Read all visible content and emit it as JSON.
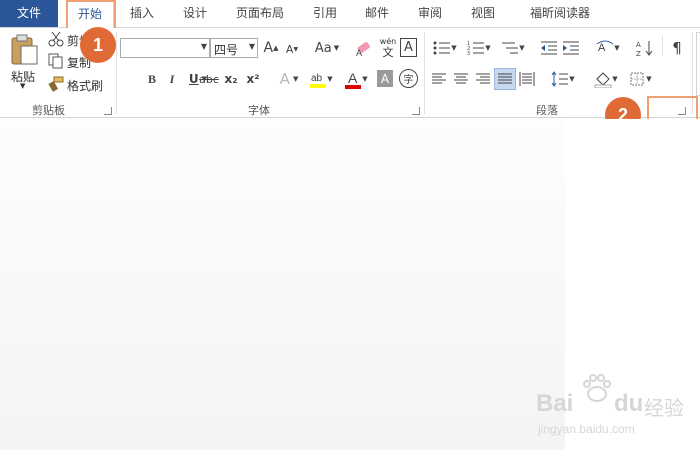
{
  "tabs": [
    {
      "label": "文件"
    },
    {
      "label": "开始"
    },
    {
      "label": "插入"
    },
    {
      "label": "设计"
    },
    {
      "label": "页面布局"
    },
    {
      "label": "引用"
    },
    {
      "label": "邮件"
    },
    {
      "label": "审阅"
    },
    {
      "label": "视图"
    },
    {
      "label": "福昕阅读器"
    }
  ],
  "badges": {
    "one": "1",
    "two": "2"
  },
  "clipboard": {
    "paste_label": "粘贴",
    "cut_label": "剪切",
    "copy_label": "复制",
    "format_painter_label": "格式刷",
    "group_label": "剪贴板"
  },
  "font": {
    "font_name_value": "",
    "font_size_value": "四号",
    "change_case_label": "Aa",
    "phonetic_top": "wén",
    "phonetic_bottom": "文",
    "char_border_label": "A",
    "bold": "B",
    "italic": "I",
    "underline": "U",
    "strike": "abc",
    "subscript": "x₂",
    "superscript": "x²",
    "font_color_label": "A",
    "char_shading_label": "A",
    "enclose_char": "字",
    "group_label": "字体"
  },
  "paragraph": {
    "group_label": "段落"
  },
  "watermark": {
    "brand": "Bai",
    "brand2": "du",
    "cn": "经验",
    "url": "jingyan.baidu.com"
  },
  "colors": {
    "file_tab": "#2b579a",
    "accent_box": "#f0a070",
    "badge": "#e06a36",
    "highlight": "#ffff00",
    "font_red": "#e00000"
  }
}
